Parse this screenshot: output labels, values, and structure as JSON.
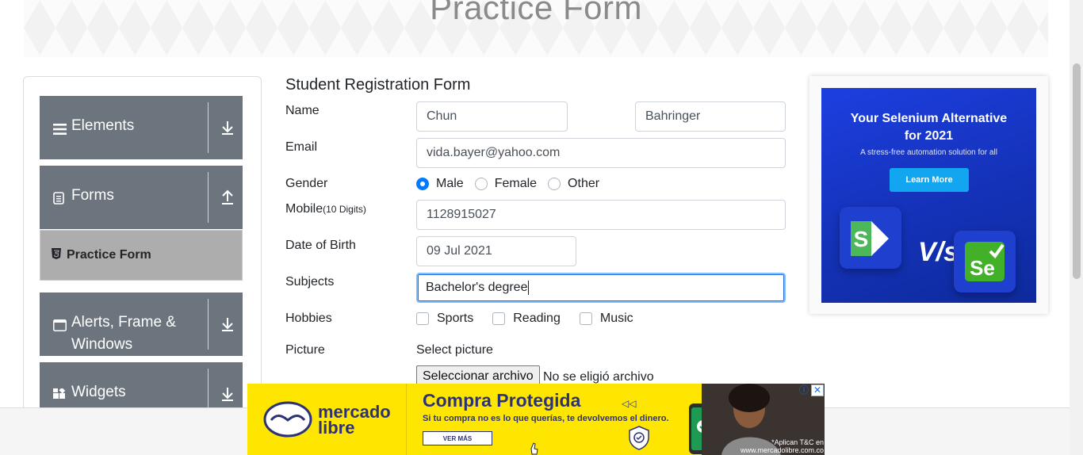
{
  "header": {
    "title": "Practice Form"
  },
  "sidebar": {
    "groups": [
      {
        "label": "Elements",
        "icon": "hamburger-icon",
        "arrow": "down"
      },
      {
        "label": "Forms",
        "icon": "form-icon",
        "arrow": "up"
      },
      {
        "label_line1": "Alerts, Frame &",
        "label_line2": "Windows",
        "icon": "window-icon",
        "arrow": "down"
      },
      {
        "label": "Widgets",
        "icon": "widgets-icon",
        "arrow": "down"
      }
    ],
    "active_item": "Practice Form"
  },
  "form": {
    "title": "Student Registration Form",
    "name_label": "Name",
    "first_name": "Chun",
    "last_name": "Bahringer",
    "email_label": "Email",
    "email": "vida.bayer@yahoo.com",
    "gender_label": "Gender",
    "gender_options": [
      "Male",
      "Female",
      "Other"
    ],
    "gender_selected": "Male",
    "mobile_label": "Mobile",
    "mobile_hint": "(10 Digits)",
    "mobile": "1128915027",
    "dob_label": "Date of Birth",
    "dob": "09 Jul 2021",
    "subjects_label": "Subjects",
    "subjects": "Bachelor's degree",
    "hobbies_label": "Hobbies",
    "hobbies": [
      "Sports",
      "Reading",
      "Music"
    ],
    "picture_label": "Picture",
    "picture_prompt": "Select picture",
    "file_button": "Seleccionar archivo",
    "file_status": "No se eligió archivo"
  },
  "side_ad": {
    "headline_line1": "Your Selenium Alternative",
    "headline_line2": "for 2021",
    "subline": "A stress-free automation solution for all",
    "button": "Learn More",
    "versus": "V/s",
    "logo_left": "S",
    "logo_right": "Se"
  },
  "bottom_ad": {
    "brand_line1": "mercado",
    "brand_line2": "libre",
    "title": "Compra Protegida",
    "subtitle": "Si tu compra no es lo que querías, te devolvemos el dinero.",
    "button": "VER MÁS",
    "legal_line1": "*Aplican T&C en",
    "legal_line2": "www.mercadolibre.com.co"
  },
  "colors": {
    "sidebar_group": "#6c757d",
    "sidebar_active": "#adadad",
    "accent": "#007bff",
    "ad_yellow": "#ffe600"
  }
}
